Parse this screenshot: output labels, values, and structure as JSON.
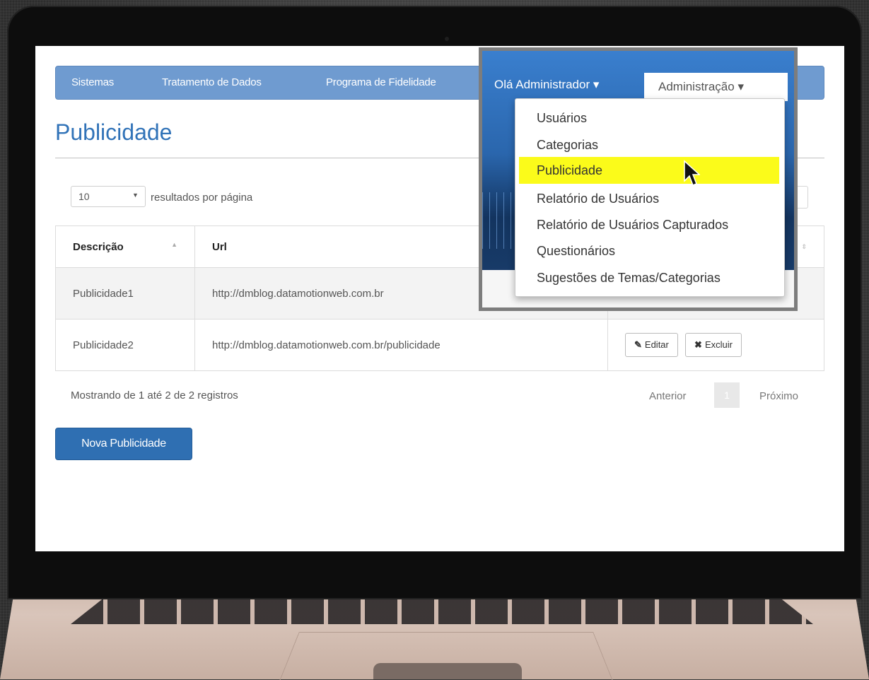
{
  "navbar": {
    "items": [
      "Sistemas",
      "Tratamento de Dados",
      "Programa de Fidelidade"
    ],
    "user_label": "Olá Administrador",
    "admin_label": "Administração"
  },
  "page": {
    "title": "Publicidade"
  },
  "table_controls": {
    "length_value": "10",
    "length_suffix": "resultados por página"
  },
  "table": {
    "headers": [
      "Descrição",
      "Url"
    ],
    "rows": [
      {
        "descricao": "Publicidade1",
        "url": "http://dmblog.datamotionweb.com.br"
      },
      {
        "descricao": "Publicidade2",
        "url": "http://dmblog.datamotionweb.com.br/publicidade"
      }
    ],
    "edit_label": "Editar",
    "delete_label": "Excluir"
  },
  "footer": {
    "info": "Mostrando de 1 até 2 de 2 registros",
    "prev": "Anterior",
    "current_page": "1",
    "next": "Próximo"
  },
  "new_button": "Nova Publicidade",
  "admin_menu": {
    "items": [
      "Usuários",
      "Categorias",
      "Publicidade",
      "Relatório de Usuários",
      "Relatório de Usuários Capturados",
      "Questionários",
      "Sugestões de Temas/Categorias"
    ],
    "active_index": 2
  },
  "colors": {
    "navbar": "#6f9bd0",
    "title": "#3173b8",
    "primary_button": "#2f6fb2",
    "highlight": "#fbfb1a"
  },
  "icons": [
    "caret-down-icon",
    "sort-asc-icon",
    "edit-icon",
    "close-icon",
    "mouse-cursor-icon"
  ]
}
